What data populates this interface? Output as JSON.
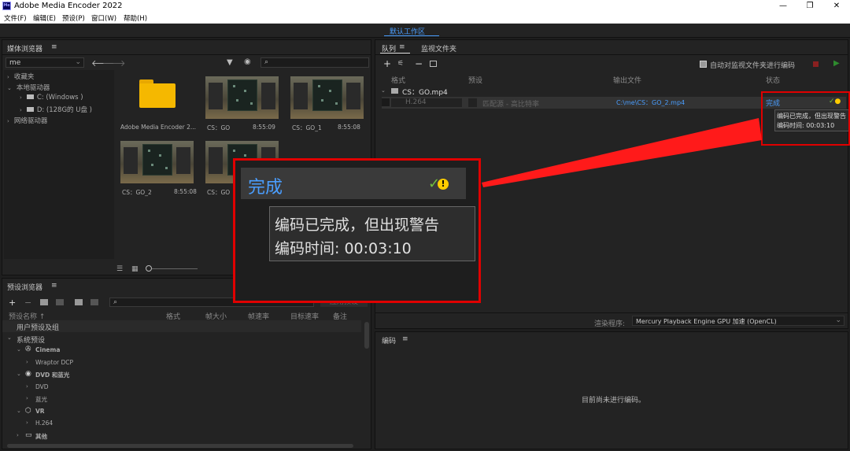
{
  "app": {
    "title": "Adobe Media Encoder 2022",
    "icon_text": "Me"
  },
  "window_controls": {
    "minimize": "—",
    "restore": "❐",
    "close": "✕"
  },
  "menu": [
    "文件(F)",
    "编辑(E)",
    "预设(P)",
    "窗口(W)",
    "帮助(H)"
  ],
  "workspace": {
    "label": "默认工作区"
  },
  "media_browser": {
    "title": "媒体浏览器",
    "menu_glyph": "≡",
    "location": "me",
    "search_placeholder": "",
    "tree": [
      {
        "label": "收藏夹",
        "indent": 0,
        "arrow": "›"
      },
      {
        "label": "本地驱动器",
        "indent": 0,
        "arrow": "⌄"
      },
      {
        "label": "C: (Windows )",
        "indent": 1,
        "arrow": "›"
      },
      {
        "label": "D: (128G的 U盘 )",
        "indent": 1,
        "arrow": "›"
      },
      {
        "label": "网络驱动器",
        "indent": 0,
        "arrow": "›"
      }
    ],
    "items": [
      {
        "name": "Adobe Media Encoder 2...",
        "duration": "",
        "type": "folder"
      },
      {
        "name": "CS：GO",
        "duration": "8:55:09",
        "type": "video"
      },
      {
        "name": "CS：GO_1",
        "duration": "8:55:08",
        "type": "video"
      },
      {
        "name": "CS：GO_2",
        "duration": "8:55:08",
        "type": "video"
      },
      {
        "name": "CS：GO",
        "duration": "",
        "type": "video"
      }
    ]
  },
  "preset_browser": {
    "title": "预设浏览器",
    "menu_glyph": "≡",
    "apply_label": "应用预设",
    "columns": [
      "预设名称 ↑",
      "格式",
      "帧大小",
      "帧速率",
      "目标速率",
      "备注"
    ],
    "rows": [
      {
        "label": "用户预设及组",
        "indent": 0,
        "arrow": "",
        "icon": ""
      },
      {
        "label": "系统预设",
        "indent": 0,
        "arrow": "⌄",
        "icon": ""
      },
      {
        "label": "Cinema",
        "indent": 1,
        "arrow": "⌄",
        "icon": "cinema-icon"
      },
      {
        "label": "Wraptor DCP",
        "indent": 2,
        "arrow": "›",
        "icon": ""
      },
      {
        "label": "DVD 和蓝光",
        "indent": 1,
        "arrow": "⌄",
        "icon": "disc-icon"
      },
      {
        "label": "DVD",
        "indent": 2,
        "arrow": "›",
        "icon": ""
      },
      {
        "label": "蓝光",
        "indent": 2,
        "arrow": "›",
        "icon": ""
      },
      {
        "label": "VR",
        "indent": 1,
        "arrow": "⌄",
        "icon": "vr-icon"
      },
      {
        "label": "H.264",
        "indent": 2,
        "arrow": "›",
        "icon": ""
      },
      {
        "label": "其他",
        "indent": 1,
        "arrow": "›",
        "icon": "monitor-icon"
      }
    ]
  },
  "queue": {
    "tabs": [
      "队列",
      "监视文件夹"
    ],
    "menu_glyph": "≡",
    "auto_encode_label": "自动对监视文件夹进行编码",
    "columns": [
      "格式",
      "预设",
      "输出文件",
      "状态"
    ],
    "source": "CS：GO.mp4",
    "job": {
      "format": "H.264",
      "preset": "匹配源 - 高比特率",
      "output": "C:\\me\\CS：GO_2.mp4",
      "status": "完成"
    },
    "tooltip": [
      "编码已完成，但出现警告",
      "编码时间: 00:03:10"
    ],
    "renderer_label": "渲染程序:",
    "renderer_value": "Mercury Playback Engine GPU 加速 (OpenCL)"
  },
  "zoom_callout": {
    "status": "完成",
    "line1": "编码已完成，但出现警告",
    "line2": "编码时间: 00:03:10"
  },
  "encoding": {
    "title": "编码",
    "menu_glyph": "≡",
    "empty_message": "目前尚未进行编码。"
  },
  "colors": {
    "accent": "#4a9eff",
    "highlight": "#e00000",
    "panel": "#232323"
  }
}
